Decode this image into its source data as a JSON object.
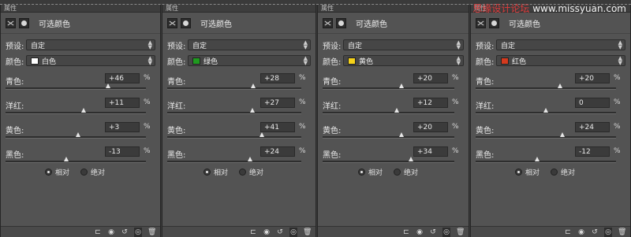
{
  "watermark": {
    "brand": "思缘设计论坛",
    "site": "www.missyuan.com"
  },
  "panel_title": "可选颜色",
  "preset_label": "预设:",
  "preset_value": "自定",
  "colors_label": "颜色:",
  "method": {
    "relative": "相对",
    "absolute": "绝对"
  },
  "panels": [
    {
      "tab": "属性",
      "color_name": "白色",
      "swatch": "#ffffff",
      "sliders": [
        {
          "label": "青色:",
          "value": "+46",
          "pct": "%",
          "amount": 46
        },
        {
          "label": "洋红:",
          "value": "+11",
          "pct": "%",
          "amount": 11
        },
        {
          "label": "黄色:",
          "value": "+3",
          "pct": "%",
          "amount": 3
        },
        {
          "label": "黑色:",
          "value": "-13",
          "pct": "%",
          "amount": -13
        }
      ]
    },
    {
      "tab": "属性",
      "color_name": "绿色",
      "swatch": "#1f9a1f",
      "sliders": [
        {
          "label": "青色:",
          "value": "+28",
          "pct": "%",
          "amount": 28
        },
        {
          "label": "洋红:",
          "value": "+27",
          "pct": "%",
          "amount": 27
        },
        {
          "label": "黄色:",
          "value": "+41",
          "pct": "%",
          "amount": 41
        },
        {
          "label": "黑色:",
          "value": "+24",
          "pct": "%",
          "amount": 24
        }
      ]
    },
    {
      "tab": "属性",
      "color_name": "黄色",
      "swatch": "#f5d21a",
      "sliders": [
        {
          "label": "青色:",
          "value": "+20",
          "pct": "%",
          "amount": 20
        },
        {
          "label": "洋红:",
          "value": "+12",
          "pct": "%",
          "amount": 12
        },
        {
          "label": "黄色:",
          "value": "+20",
          "pct": "%",
          "amount": 20
        },
        {
          "label": "黑色:",
          "value": "+34",
          "pct": "%",
          "amount": 34
        }
      ]
    },
    {
      "tab": "属性",
      "color_name": "红色",
      "swatch": "#d43a1e",
      "sliders": [
        {
          "label": "青色:",
          "value": "+20",
          "pct": "%",
          "amount": 20
        },
        {
          "label": "洋红:",
          "value": "0",
          "pct": "%",
          "amount": 0
        },
        {
          "label": "黄色:",
          "value": "+24",
          "pct": "%",
          "amount": 24
        },
        {
          "label": "黑色:",
          "value": "-12",
          "pct": "%",
          "amount": -12
        }
      ]
    }
  ],
  "footer_icons": [
    "clip-to-layer-icon",
    "eye-preview-icon",
    "reset-icon",
    "visibility-icon",
    "trash-icon"
  ]
}
